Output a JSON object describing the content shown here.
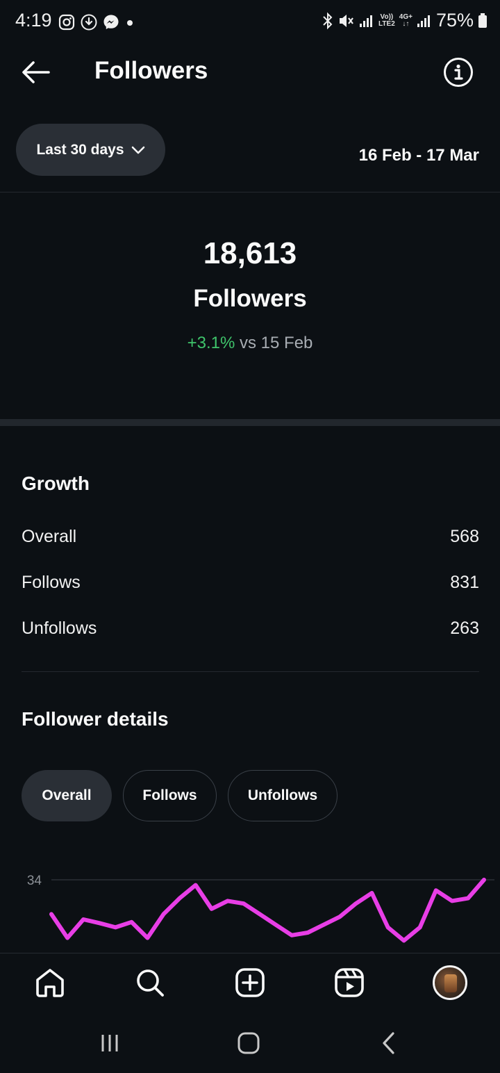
{
  "status_bar": {
    "time": "4:19",
    "battery": "75%",
    "network_top": "Vo))",
    "network_bottom": "LTE2",
    "network2": "4G+"
  },
  "header": {
    "title": "Followers"
  },
  "filter": {
    "range_label": "Last 30 days",
    "date_range": "16 Feb - 17 Mar"
  },
  "summary": {
    "count": "18,613",
    "label": "Followers",
    "change": "+3.1%",
    "comparison": "vs 15 Feb"
  },
  "growth": {
    "title": "Growth",
    "rows": [
      {
        "label": "Overall",
        "value": "568"
      },
      {
        "label": "Follows",
        "value": "831"
      },
      {
        "label": "Unfollows",
        "value": "263"
      }
    ]
  },
  "details": {
    "title": "Follower details",
    "tabs": [
      "Overall",
      "Follows",
      "Unfollows"
    ],
    "active_tab": "Overall"
  },
  "chart_data": {
    "type": "line",
    "y_tick_labels": [
      "34"
    ],
    "ylim": [
      16,
      34
    ],
    "grid": true,
    "series": [
      {
        "color": "#e83ee6",
        "values": [
          27.5,
          23,
          26.5,
          25.8,
          25,
          26,
          23,
          27.5,
          30.5,
          33,
          28.5,
          30,
          29.5,
          27.5,
          25.5,
          23.5,
          24,
          25.5,
          27,
          29.5,
          31.5,
          25,
          22.5,
          25,
          32,
          30,
          30.5,
          34
        ]
      }
    ]
  },
  "colors": {
    "background": "#0c1014",
    "accent_positive": "#3fc46b",
    "chart_line": "#e83ee6"
  },
  "icons": {
    "back": "arrow-left-icon",
    "info": "info-icon",
    "home": "home-icon",
    "search": "search-icon",
    "create": "plus-square-icon",
    "reels": "reels-icon",
    "profile": "avatar"
  }
}
